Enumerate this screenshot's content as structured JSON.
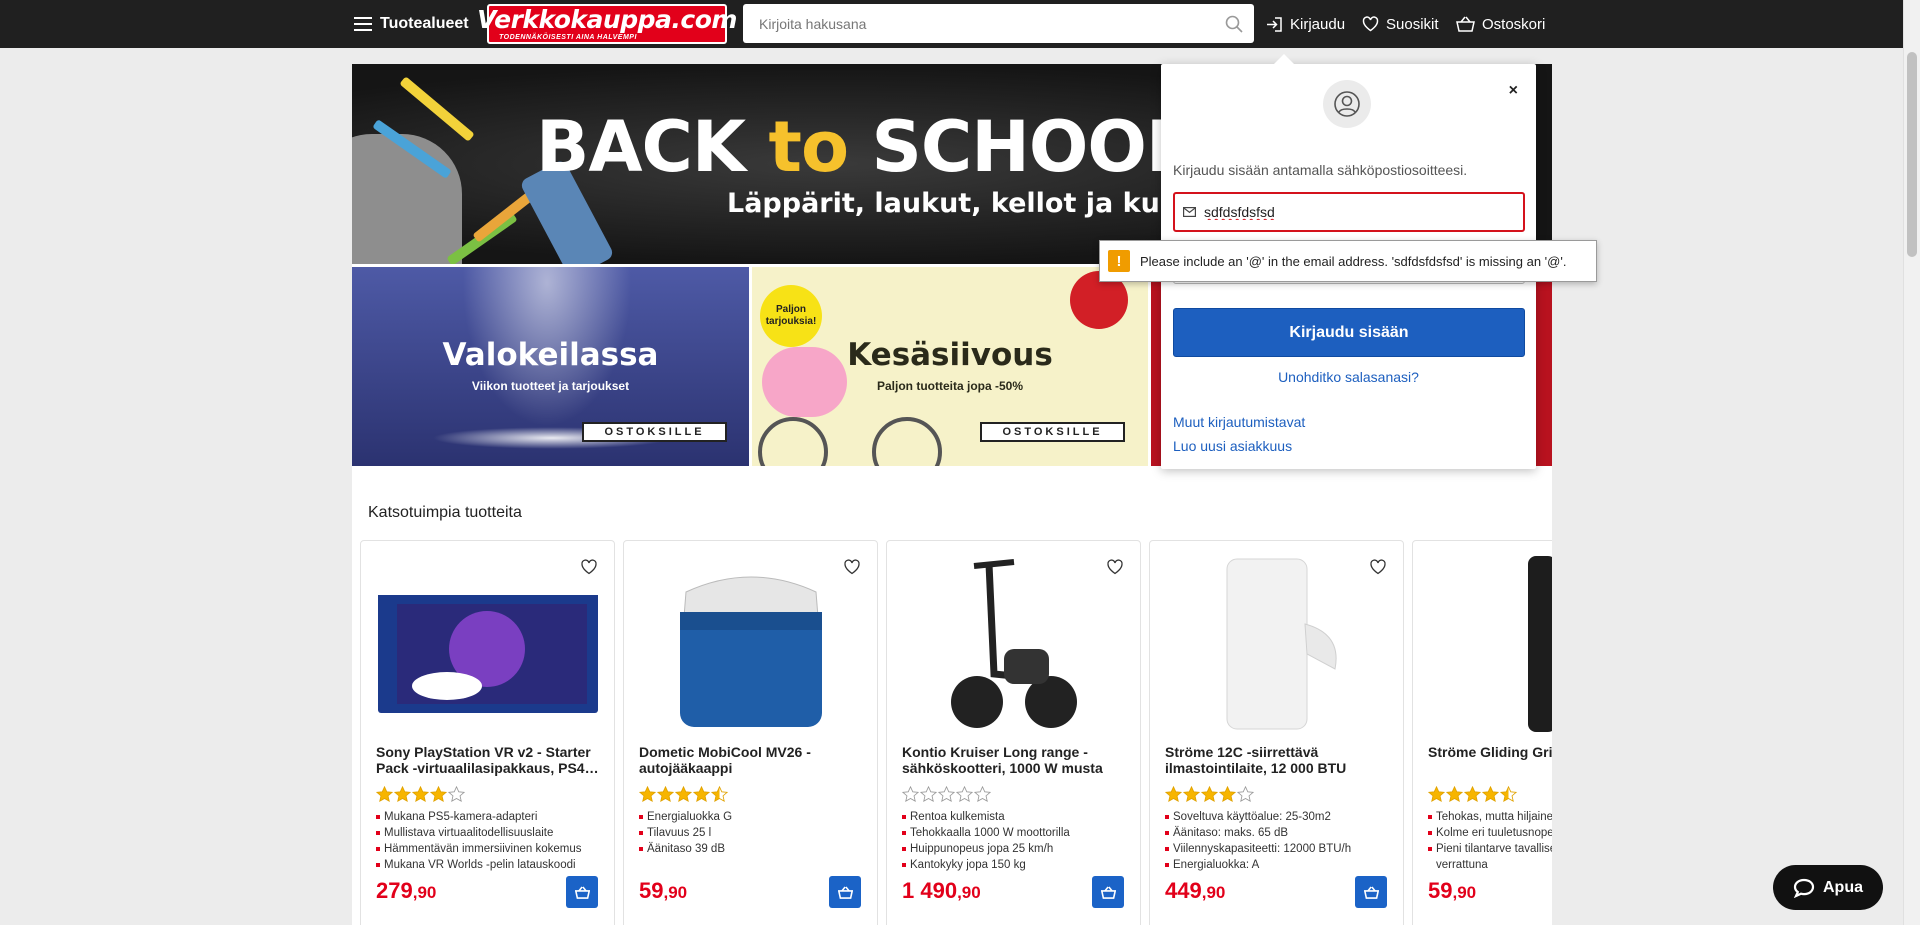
{
  "header": {
    "menu_label": "Tuotealueet",
    "logo_main": "Verkkokauppa.com",
    "logo_tagline": "TODENNÄKÖISESTI AINA HALVEMPI",
    "search_placeholder": "Kirjoita hakusana",
    "login_label": "Kirjaudu",
    "favorites_label": "Suosikit",
    "cart_label": "Ostoskori"
  },
  "hero": {
    "title_part1": "BACK ",
    "title_part2": "to",
    "title_part3": " SCHOOL &",
    "subtitle": "Läppärit, laukut, kellot ja kuulokkeet"
  },
  "tiles": [
    {
      "title": "Valokeilassa",
      "subtitle": "Viikon tuotteet ja tarjoukset",
      "cta": "OSTOKSILLE"
    },
    {
      "title": "Kesäsiivous",
      "subtitle": "Paljon tuotteita jopa -50%",
      "cta": "OSTOKSILLE",
      "badge": "Paljon tarjouksia!"
    }
  ],
  "section_title": "Katsotuimpia tuotteita",
  "products": [
    {
      "name": "Sony PlayStation VR v2 - Starter Pack -virtuaalilasipakkaus, PS4…",
      "rating": 4,
      "features": [
        "Mukana PS5-kamera-adapteri",
        "Mullistava virtuaalitodellisuuslaite",
        "Hämmentävän immersiivinen kokemus",
        "Mukana VR Worlds -pelin latauskoodi"
      ],
      "price_int": "279",
      "price_dec": ",90"
    },
    {
      "name": "Dometic MobiCool MV26 - autojääkaappi",
      "rating": 4.5,
      "features": [
        "Energialuokka G",
        "Tilavuus 25 l",
        "Äänitaso 39 dB"
      ],
      "price_int": "59",
      "price_dec": ",90"
    },
    {
      "name": "Kontio Kruiser Long range - sähköskootteri, 1000 W musta",
      "rating": 0,
      "features": [
        "Rentoa kulkemista",
        "Tehokkaalla 1000 W moottorilla",
        "Huippunopeus jopa 25 km/h",
        "Kantokyky jopa 150 kg"
      ],
      "price_int": "1 490",
      "price_dec": ",90"
    },
    {
      "name": "Ströme 12C -siirrettävä ilmastointilaite, 12 000 BTU",
      "rating": 4,
      "features": [
        "Soveltuva käyttöalue: 25-30m2",
        "Äänitaso: maks. 65 dB",
        "Viilennyskapasiteetti: 12000 BTU/h",
        "Energialuokka: A"
      ],
      "price_int": "449",
      "price_dec": ",90"
    },
    {
      "name": "Ströme Gliding Grid tornituuletin",
      "rating": 4.5,
      "features": [
        "Tehokas, mutta hiljainen",
        "Kolme eri tuuletusnopeutta",
        "Pieni tilantarve tavallisen tuulettimen verrattuna"
      ],
      "price_int": "59",
      "price_dec": ",90"
    }
  ],
  "login": {
    "intro": "Kirjaudu sisään antamalla sähköpostiosoitteesi.",
    "email_value": "sdfdsfdsfsd",
    "submit_label": "Kirjaudu sisään",
    "forgot_label": "Unohditko salasanasi?",
    "other_methods_label": "Muut kirjautumistavat",
    "create_account_label": "Luo uusi asiakkuus",
    "close_label": "×"
  },
  "validation_tooltip": "Please include an '@' in the email address. 'sdfdsfdsfsd' is missing an '@'.",
  "help_label": "Apua",
  "colors": {
    "brand_red": "#e2001a",
    "primary_blue": "#1d5fbf",
    "topbar": "#202020"
  }
}
